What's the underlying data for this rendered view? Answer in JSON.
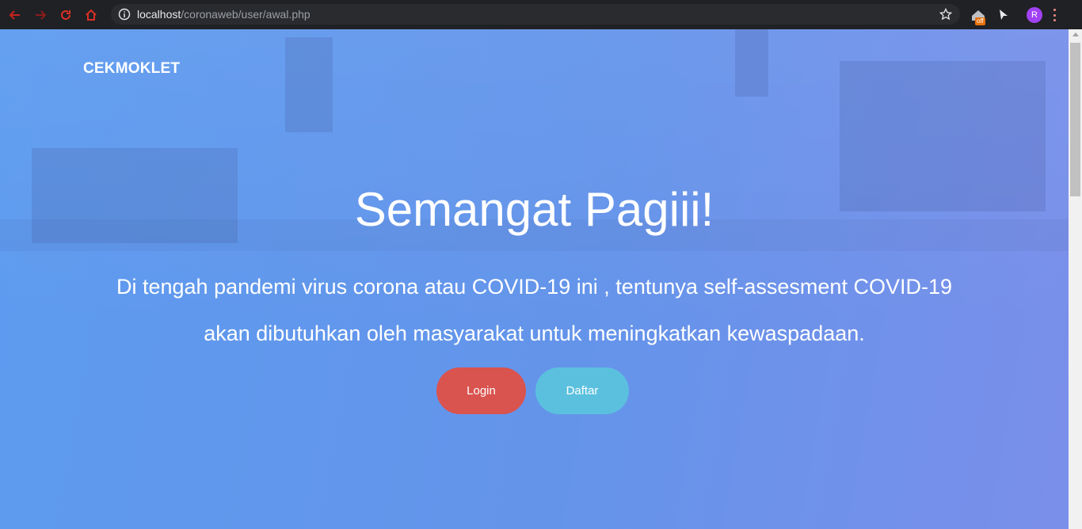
{
  "browser": {
    "url_host": "localhost",
    "url_path": "/coronaweb/user/awal.php",
    "extension_badge": "off",
    "profile_initial": "R"
  },
  "page": {
    "brand": "CEKMOKLET",
    "hero_title": "Semangat Pagiii!",
    "hero_text": "Di tengah pandemi virus corona atau COVID-19 ini , tentunya self-assesment COVID-19 akan dibutuhkan oleh masyarakat untuk meningkatkan kewaspadaan.",
    "login_label": "Login",
    "daftar_label": "Daftar"
  },
  "colors": {
    "login": "#d9534f",
    "daftar": "#5bc0de",
    "background": "#6494ea"
  }
}
